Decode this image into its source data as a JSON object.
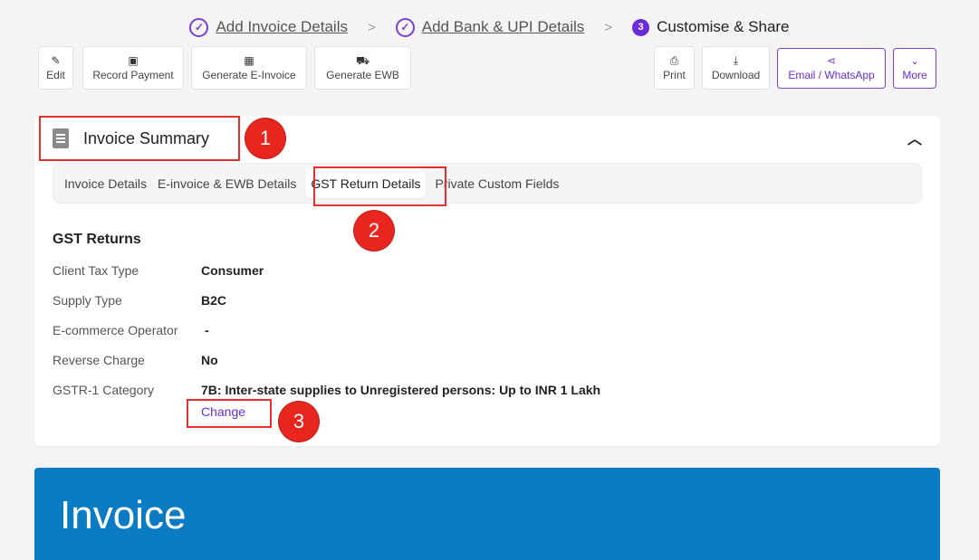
{
  "stepper": {
    "steps": [
      {
        "label": "Add Invoice Details",
        "state": "done"
      },
      {
        "label": "Add Bank & UPI Details",
        "state": "done"
      },
      {
        "label": "Customise & Share",
        "state": "active",
        "number": "3"
      }
    ],
    "separator": ">"
  },
  "toolbar": {
    "edit": "Edit",
    "record_payment": "Record Payment",
    "generate_einvoice": "Generate E-Invoice",
    "generate_ewb": "Generate EWB",
    "print": "Print",
    "download": "Download",
    "email_whatsapp": "Email / WhatsApp",
    "more": "More"
  },
  "summary": {
    "title": "Invoice Summary",
    "tabs": [
      "Invoice Details",
      "E-invoice & EWB Details",
      "GST Return Details",
      "Private Custom Fields"
    ],
    "active_tab": "GST Return Details",
    "section_title": "GST Returns",
    "rows": [
      {
        "key": "Client Tax Type",
        "value": "Consumer"
      },
      {
        "key": "Supply Type",
        "value": "B2C"
      },
      {
        "key": "E-commerce Operator",
        "value": "-"
      },
      {
        "key": "Reverse Charge",
        "value": "No"
      },
      {
        "key": "GSTR-1 Category",
        "value": "7B: Inter-state supplies to Unregistered persons: Up to INR 1 Lakh"
      }
    ],
    "change_link": "Change"
  },
  "annotations": [
    "1",
    "2",
    "3"
  ],
  "invoice_banner": {
    "title": "Invoice"
  },
  "colors": {
    "accent": "#6c2bd9",
    "banner": "#0b7bc4",
    "annotation": "#e8261f"
  }
}
